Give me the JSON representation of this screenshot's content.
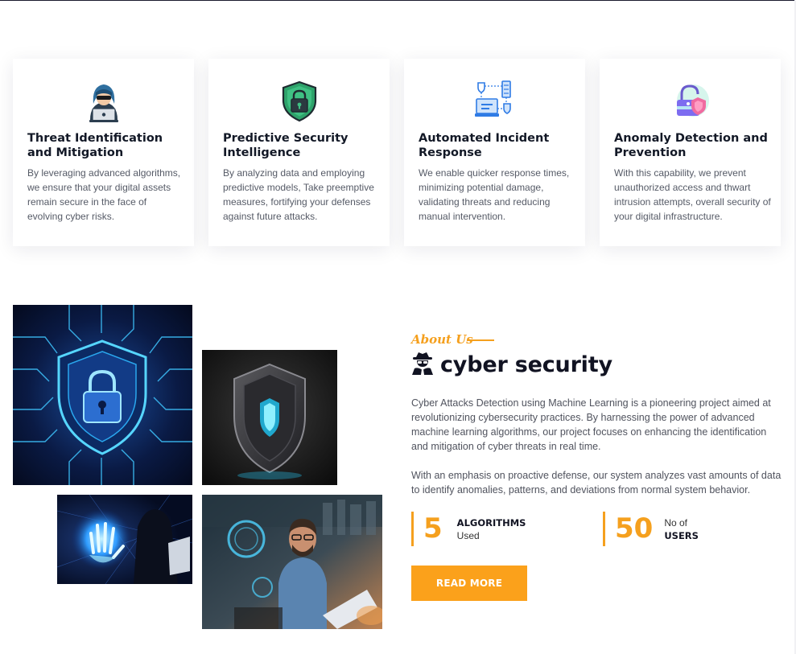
{
  "features": [
    {
      "icon": "hacker-laptop-icon",
      "title": "Threat Identification and Mitigation",
      "desc": "By leveraging advanced algorithms, we ensure that your digital assets remain secure in the face of evolving cyber risks."
    },
    {
      "icon": "shield-lock-icon",
      "title": "Predictive Security Intelligence",
      "desc": "By analyzing data and employing predictive models, Take preemptive measures, fortifying your defenses against future attacks."
    },
    {
      "icon": "network-shield-icon",
      "title": "Automated Incident Response",
      "desc": "We enable quicker response times, minimizing potential damage, validating threats and reducing manual intervention."
    },
    {
      "icon": "padlock-shield-icon",
      "title": "Anomaly Detection and Prevention",
      "desc": "With this capability, we prevent unauthorized access and thwart intrusion attempts, overall security of your digital infrastructure."
    }
  ],
  "about": {
    "tag": "About Us",
    "title": "cyber security",
    "title_icon": "spy-icon",
    "para1": "Cyber Attacks Detection using Machine Learning is a pioneering project aimed at revolutionizing cybersecurity practices. By harnessing the power of advanced machine learning algorithms, our project focuses on enhancing the identification and mitigation of cyber threats in real time.",
    "para2": "With an emphasis on proactive defense, our system analyzes vast amounts of data to identify anomalies, patterns, and deviations from normal system behavior.",
    "stats": [
      {
        "value": "5",
        "line1": "ALGORITHMS",
        "line2": "Used"
      },
      {
        "value": "50",
        "line1": "No of",
        "line2": "USERS"
      }
    ],
    "button": "READ MORE"
  },
  "colors": {
    "accent": "#f5a01e",
    "button": "#fba11b",
    "heading": "#121826",
    "body_text": "#555a66"
  }
}
